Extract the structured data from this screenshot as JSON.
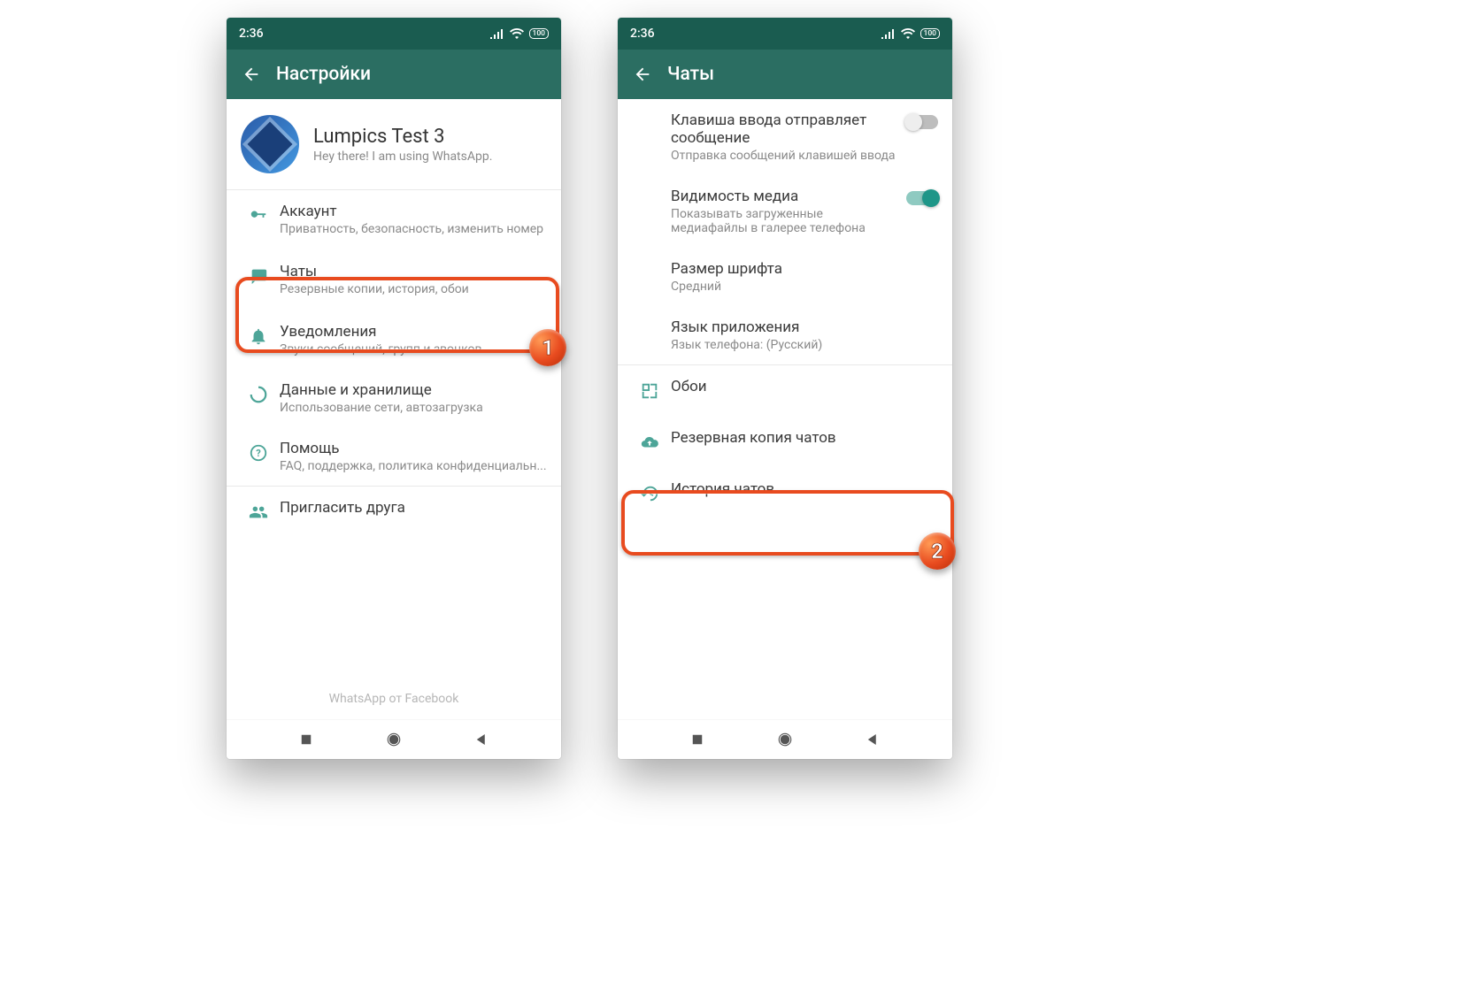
{
  "status": {
    "time": "2:36",
    "battery": "100"
  },
  "left": {
    "title": "Настройки",
    "profile": {
      "name": "Lumpics Test 3",
      "status": "Hey there! I am using WhatsApp."
    },
    "items": [
      {
        "title": "Аккаунт",
        "sub": "Приватность, безопасность, изменить номер"
      },
      {
        "title": "Чаты",
        "sub": "Резервные копии, история, обои"
      },
      {
        "title": "Уведомления",
        "sub": "Звуки сообщений, групп и звонков"
      },
      {
        "title": "Данные и хранилище",
        "sub": "Использование сети, автозагрузка"
      },
      {
        "title": "Помощь",
        "sub": "FAQ, поддержка, политика конфиденциальн..."
      },
      {
        "title": "Пригласить друга",
        "sub": ""
      }
    ],
    "footer": "WhatsApp от Facebook"
  },
  "right": {
    "title": "Чаты",
    "settings": [
      {
        "title": "Клавиша ввода отправляет сообщение",
        "sub": "Отправка сообщений клавишей ввода",
        "toggle": "off"
      },
      {
        "title": "Видимость медиа",
        "sub": "Показывать загруженные медиафайлы в галерее телефона",
        "toggle": "on"
      },
      {
        "title": "Размер шрифта",
        "sub": "Средний"
      },
      {
        "title": "Язык приложения",
        "sub": "Язык телефона: (Русский)"
      }
    ],
    "actions": [
      {
        "title": "Обои"
      },
      {
        "title": "Резервная копия чатов"
      },
      {
        "title": "История чатов"
      }
    ]
  },
  "annotations": {
    "step1": "1",
    "step2": "2"
  }
}
